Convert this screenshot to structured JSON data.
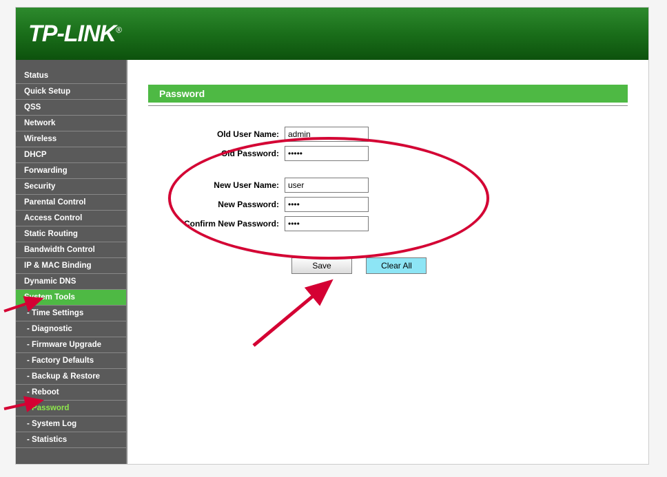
{
  "brand": {
    "name": "TP-LINK",
    "reg": "®"
  },
  "sidebar": {
    "items": [
      {
        "label": "Status",
        "sub": false
      },
      {
        "label": "Quick Setup",
        "sub": false
      },
      {
        "label": "QSS",
        "sub": false
      },
      {
        "label": "Network",
        "sub": false
      },
      {
        "label": "Wireless",
        "sub": false
      },
      {
        "label": "DHCP",
        "sub": false
      },
      {
        "label": "Forwarding",
        "sub": false
      },
      {
        "label": "Security",
        "sub": false
      },
      {
        "label": "Parental Control",
        "sub": false
      },
      {
        "label": "Access Control",
        "sub": false
      },
      {
        "label": "Static Routing",
        "sub": false
      },
      {
        "label": "Bandwidth Control",
        "sub": false
      },
      {
        "label": "IP & MAC Binding",
        "sub": false
      },
      {
        "label": "Dynamic DNS",
        "sub": false
      },
      {
        "label": "System Tools",
        "sub": false,
        "active_section": true
      },
      {
        "label": "- Time Settings",
        "sub": true
      },
      {
        "label": "- Diagnostic",
        "sub": true
      },
      {
        "label": "- Firmware Upgrade",
        "sub": true
      },
      {
        "label": "- Factory Defaults",
        "sub": true
      },
      {
        "label": "- Backup & Restore",
        "sub": true
      },
      {
        "label": "- Reboot",
        "sub": true
      },
      {
        "label": "- Password",
        "sub": true,
        "active_sub": true
      },
      {
        "label": "- System Log",
        "sub": true
      },
      {
        "label": "- Statistics",
        "sub": true
      }
    ]
  },
  "panel": {
    "title": "Password"
  },
  "form": {
    "old_user_label": "Old User Name:",
    "old_user_value": "admin",
    "old_pass_label": "Old Password:",
    "old_pass_value": "•••••",
    "new_user_label": "New User Name:",
    "new_user_value": "user",
    "new_pass_label": "New Password:",
    "new_pass_value": "••••",
    "confirm_pass_label": "Confirm New Password:",
    "confirm_pass_value": "••••"
  },
  "buttons": {
    "save": "Save",
    "clear": "Clear All"
  }
}
